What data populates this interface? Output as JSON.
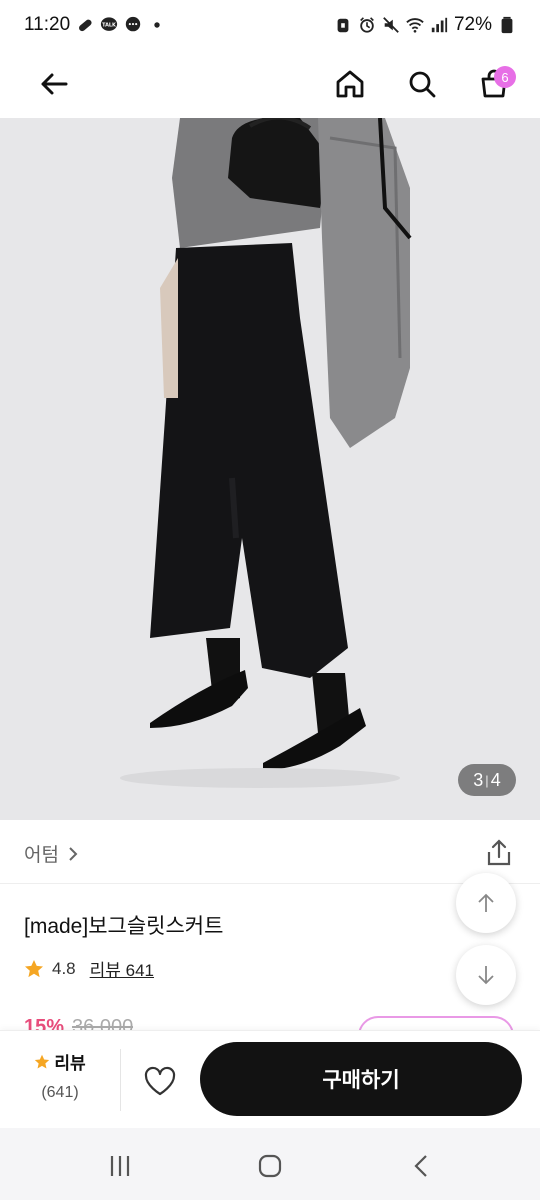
{
  "status_bar": {
    "time": "11:20",
    "battery": "72%",
    "left_icons": [
      "link-icon",
      "kakaotalk-icon",
      "chat-bubble-icon",
      "dot-icon"
    ],
    "right_icons": [
      "secure-folder-icon",
      "alarm-icon",
      "mute-icon",
      "wifi-icon",
      "signal-icon",
      "battery-icon"
    ],
    "kakao_label": "TALK"
  },
  "header": {
    "icons": [
      "back-arrow-icon",
      "home-icon",
      "search-icon",
      "shopping-bag-icon"
    ],
    "cart_count": "6"
  },
  "gallery": {
    "current": "3",
    "separator": "|",
    "total": "4"
  },
  "brand": {
    "name": "어텀",
    "share_icon": "share-icon"
  },
  "product": {
    "title": "[made]보그슬릿스커트",
    "rating": "4.8",
    "review_link": "리뷰 641",
    "discount": "15%",
    "original_price": "36,000"
  },
  "purchase_bar": {
    "review_label": "리뷰",
    "review_count": "(641)",
    "buy_label": "구매하기",
    "wish_icon": "heart-icon"
  },
  "colors": {
    "accent_pink": "#e76fe6",
    "star": "#f5a623",
    "buy_button": "#121212"
  },
  "nav_bar": {
    "icons": [
      "recent-apps-icon",
      "home-circle-icon",
      "back-chevron-icon"
    ]
  }
}
